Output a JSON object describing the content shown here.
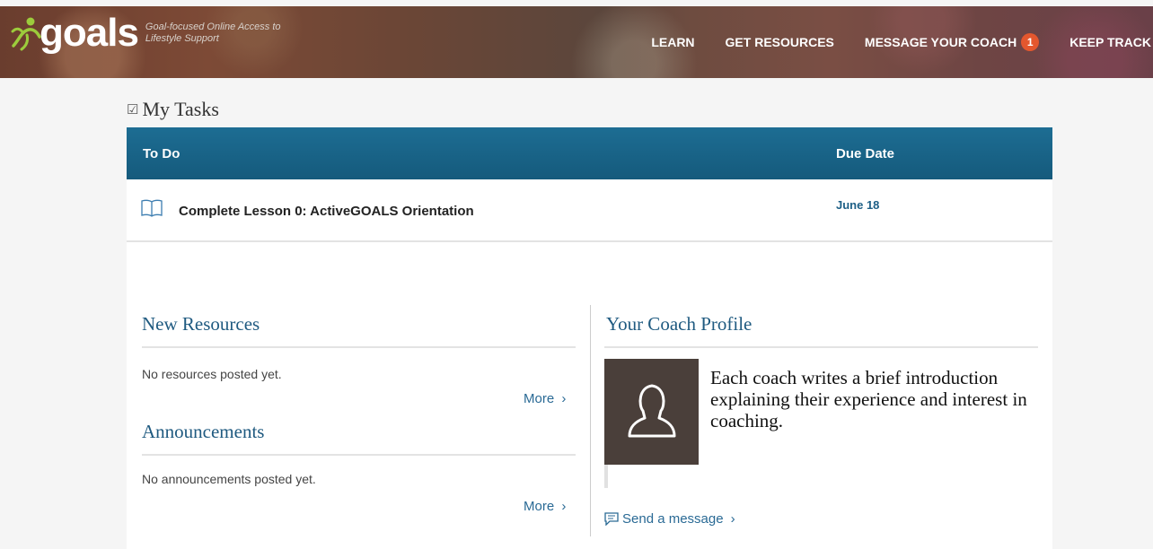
{
  "header": {
    "logo_word": "goals",
    "tagline": "Goal-focused Online Access to Lifestyle Support",
    "nav": [
      {
        "label": "LEARN"
      },
      {
        "label": "GET RESOURCES"
      },
      {
        "label": "MESSAGE YOUR COACH",
        "badge": "1"
      },
      {
        "label": "KEEP TRACK"
      }
    ]
  },
  "tasks": {
    "title": "My Tasks",
    "columns": {
      "todo": "To Do",
      "due": "Due Date"
    },
    "rows": [
      {
        "name": "Complete Lesson 0: ActiveGOALS Orientation",
        "due": "June 18"
      }
    ]
  },
  "resources": {
    "title": "New Resources",
    "empty_text": "No resources posted yet.",
    "more_label": "More"
  },
  "announcements": {
    "title": "Announcements",
    "empty_text": "No announcements posted yet.",
    "more_label": "More"
  },
  "coach": {
    "title": "Your Coach Profile",
    "bio": "Each coach writes a brief introduction explaining their experience and interest in coaching.",
    "send_label": "Send a message"
  },
  "colors": {
    "table_header": "#1d6d93",
    "link": "#2a6a95",
    "section_title": "#1f5a80",
    "badge": "#e4572e",
    "coach_photo_bg": "#4a3f3a"
  },
  "icons": [
    "logo-figure-icon",
    "checkbox-icon",
    "book-icon",
    "chevron-right-icon",
    "user-silhouette-icon",
    "chat-bubble-icon"
  ]
}
